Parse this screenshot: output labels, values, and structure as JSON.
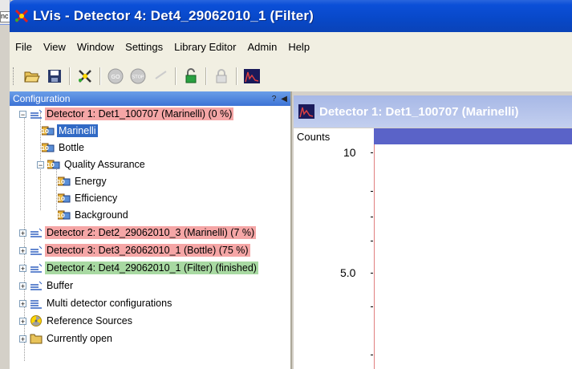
{
  "window": {
    "title": "LVis - Detector 4: Det4_29062010_1 (Filter)",
    "bg_fragment_text": "nc"
  },
  "menu": [
    "File",
    "View",
    "Window",
    "Settings",
    "Library Editor",
    "Admin",
    "Help"
  ],
  "toolbar": {
    "buttons": [
      "open-icon",
      "save-icon",
      "detector-icon",
      "go-icon",
      "stop-icon",
      "check-icon",
      "lock-open-icon",
      "lock-icon",
      "spectrum-icon"
    ]
  },
  "config": {
    "header": "Configuration",
    "help": "?",
    "tree": {
      "det1": "Detector 1: Det1_100707 (Marinelli) (0 %)",
      "marinelli": "Marinelli",
      "bottle": "Bottle",
      "qa": "Quality Assurance",
      "energy": "Energy",
      "efficiency": "Efficiency",
      "background": "Background",
      "det2": "Detector 2: Det2_29062010_3 (Marinelli) (7 %)",
      "det3": "Detector 3: Det3_26062010_1 (Bottle) (75 %)",
      "det4": "Detector 4: Det4_29062010_1 (Filter) (finished)",
      "buffer": "Buffer",
      "multi": "Multi detector configurations",
      "ref": "Reference Sources",
      "open": "Currently open"
    }
  },
  "detector_view": {
    "title": "Detector 1: Det1_100707 (Marinelli)",
    "ylabel": "Counts",
    "tick_10": "10",
    "tick_5": "5.0"
  },
  "colors": {
    "titlebar": "#0848c8",
    "running": "#f5a6a6",
    "finished": "#a8d9a2",
    "selection": "#316ac5"
  }
}
